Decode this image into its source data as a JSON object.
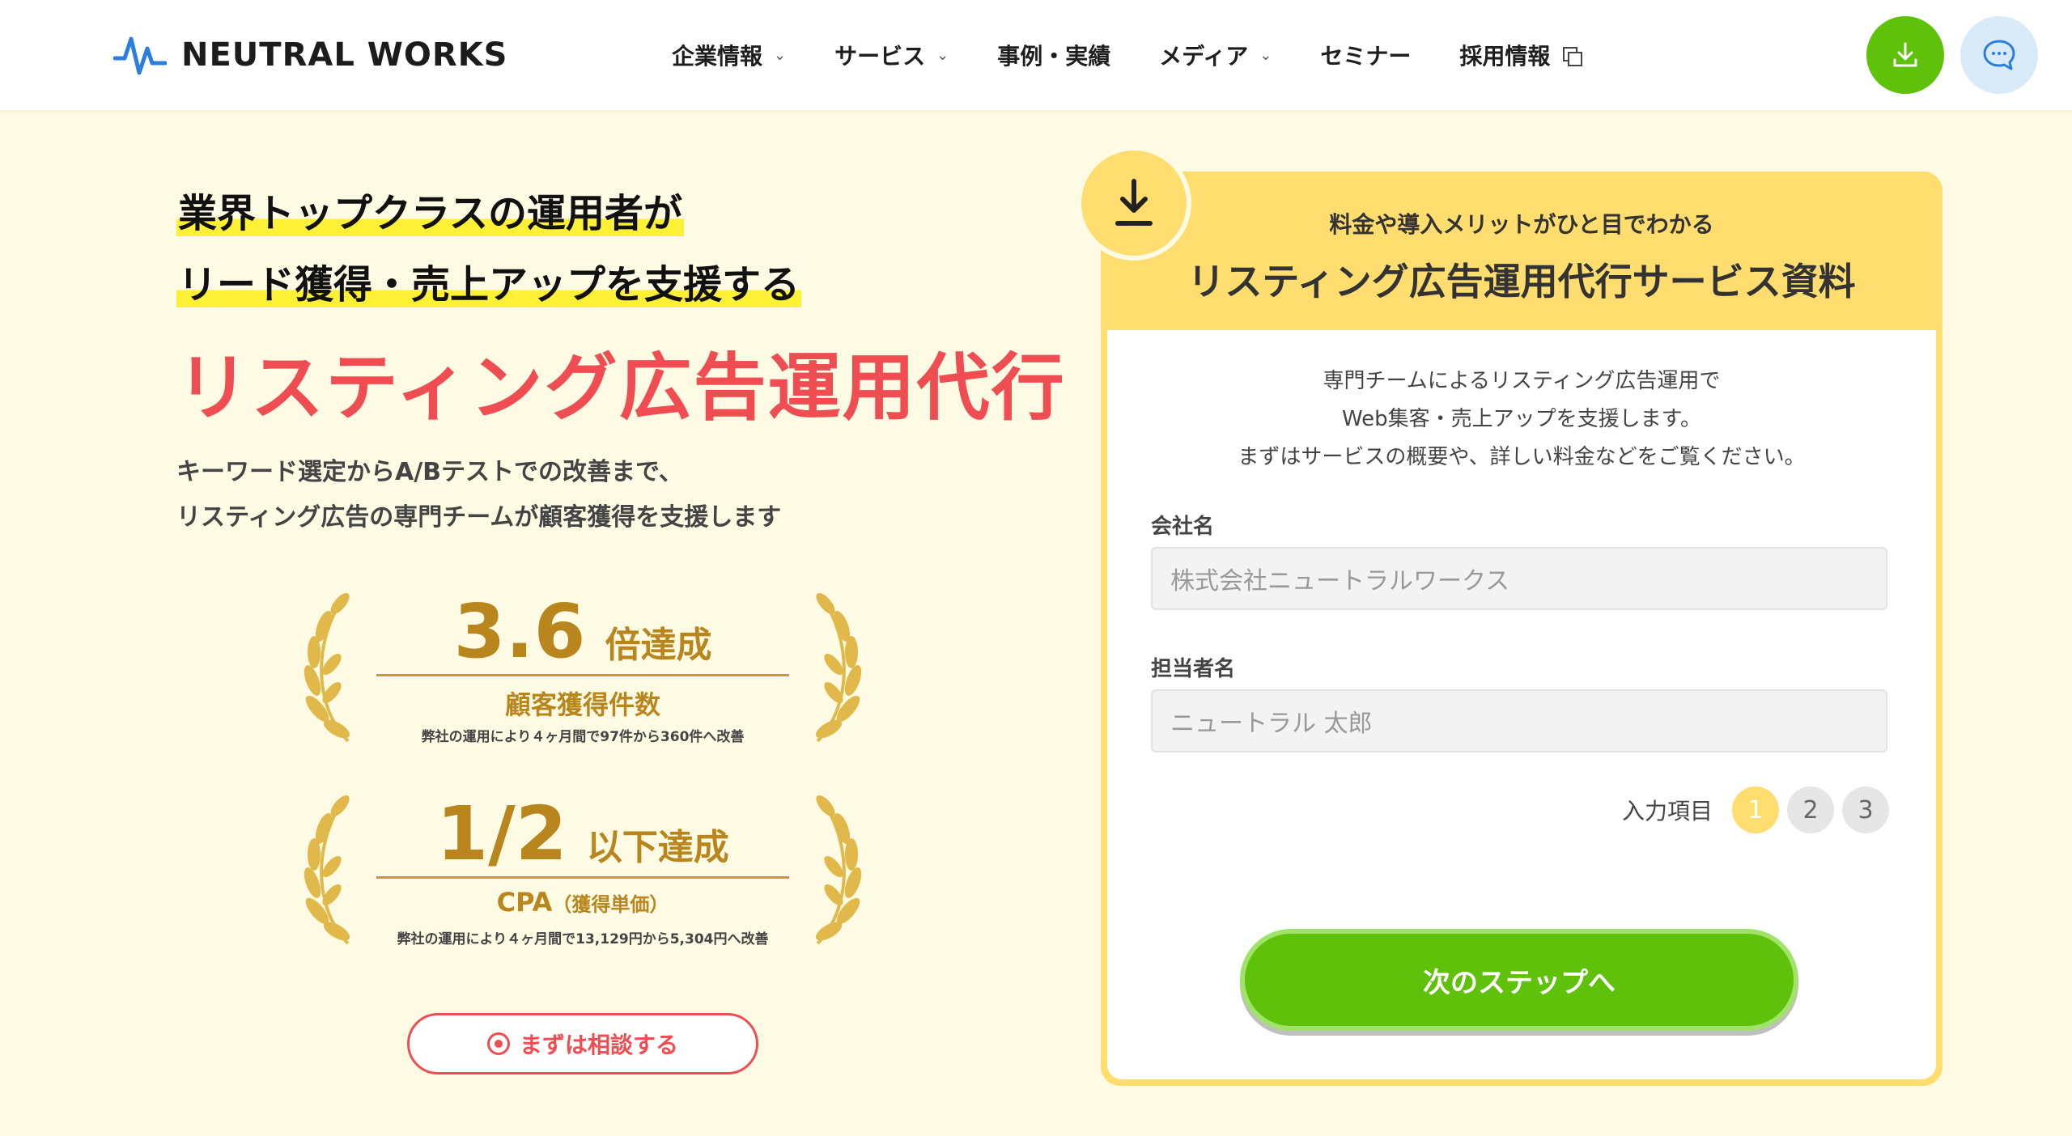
{
  "brand": {
    "name": "NEUTRAL WORKS"
  },
  "nav": {
    "items": [
      {
        "label": "企業情報",
        "has_dropdown": true
      },
      {
        "label": "サービス",
        "has_dropdown": true
      },
      {
        "label": "事例・実績",
        "has_dropdown": false
      },
      {
        "label": "メディア",
        "has_dropdown": true
      },
      {
        "label": "セミナー",
        "has_dropdown": false
      },
      {
        "label": "採用情報",
        "external": true
      }
    ],
    "caret": "⌄"
  },
  "header_buttons": {
    "download_icon": "download-icon",
    "chat_icon": "chat-icon"
  },
  "hero": {
    "headline_1": "業界トップクラスの運用者が",
    "headline_2": "リード獲得・売上アップを支援する",
    "title": "リスティング広告運用代行",
    "desc_1": "キーワード選定からA/Bテストでの改善まで、",
    "desc_2": "リスティング広告の専門チームが顧客獲得を支援します"
  },
  "stats": [
    {
      "number": "3.6",
      "unit": "倍達成",
      "label": "顧客獲得件数",
      "label_small": "",
      "note": "弊社の運用により４ヶ月間で97件から360件へ改善"
    },
    {
      "number": "1/2",
      "unit": "以下達成",
      "label": "CPA",
      "label_small": "（獲得単価）",
      "note": "弊社の運用により４ヶ月間で13,129円から5,304円へ改善"
    }
  ],
  "consult_button": "まずは相談する",
  "form": {
    "subtitle": "料金や導入メリットがひと目でわかる",
    "title": "リスティング広告運用代行サービス資料",
    "intro_1": "専門チームによるリスティング広告運用で",
    "intro_2": "Web集客・売上アップを支援します。",
    "intro_3": "まずはサービスの概要や、詳しい料金などをご覧ください。",
    "company_label": "会社名",
    "company_placeholder": "株式会社ニュートラルワークス",
    "person_label": "担当者名",
    "person_placeholder": "ニュートラル 太郎",
    "steps_label": "入力項目",
    "steps": [
      "1",
      "2",
      "3"
    ],
    "current_step": "1",
    "next_button": "次のステップへ"
  },
  "colors": {
    "accent_red": "#f04d52",
    "accent_green": "#5fc10a",
    "gold": "#b8861d",
    "card_yellow": "#ffdd6e",
    "highlight_yellow": "#fdf035",
    "background": "#fefbe4"
  }
}
